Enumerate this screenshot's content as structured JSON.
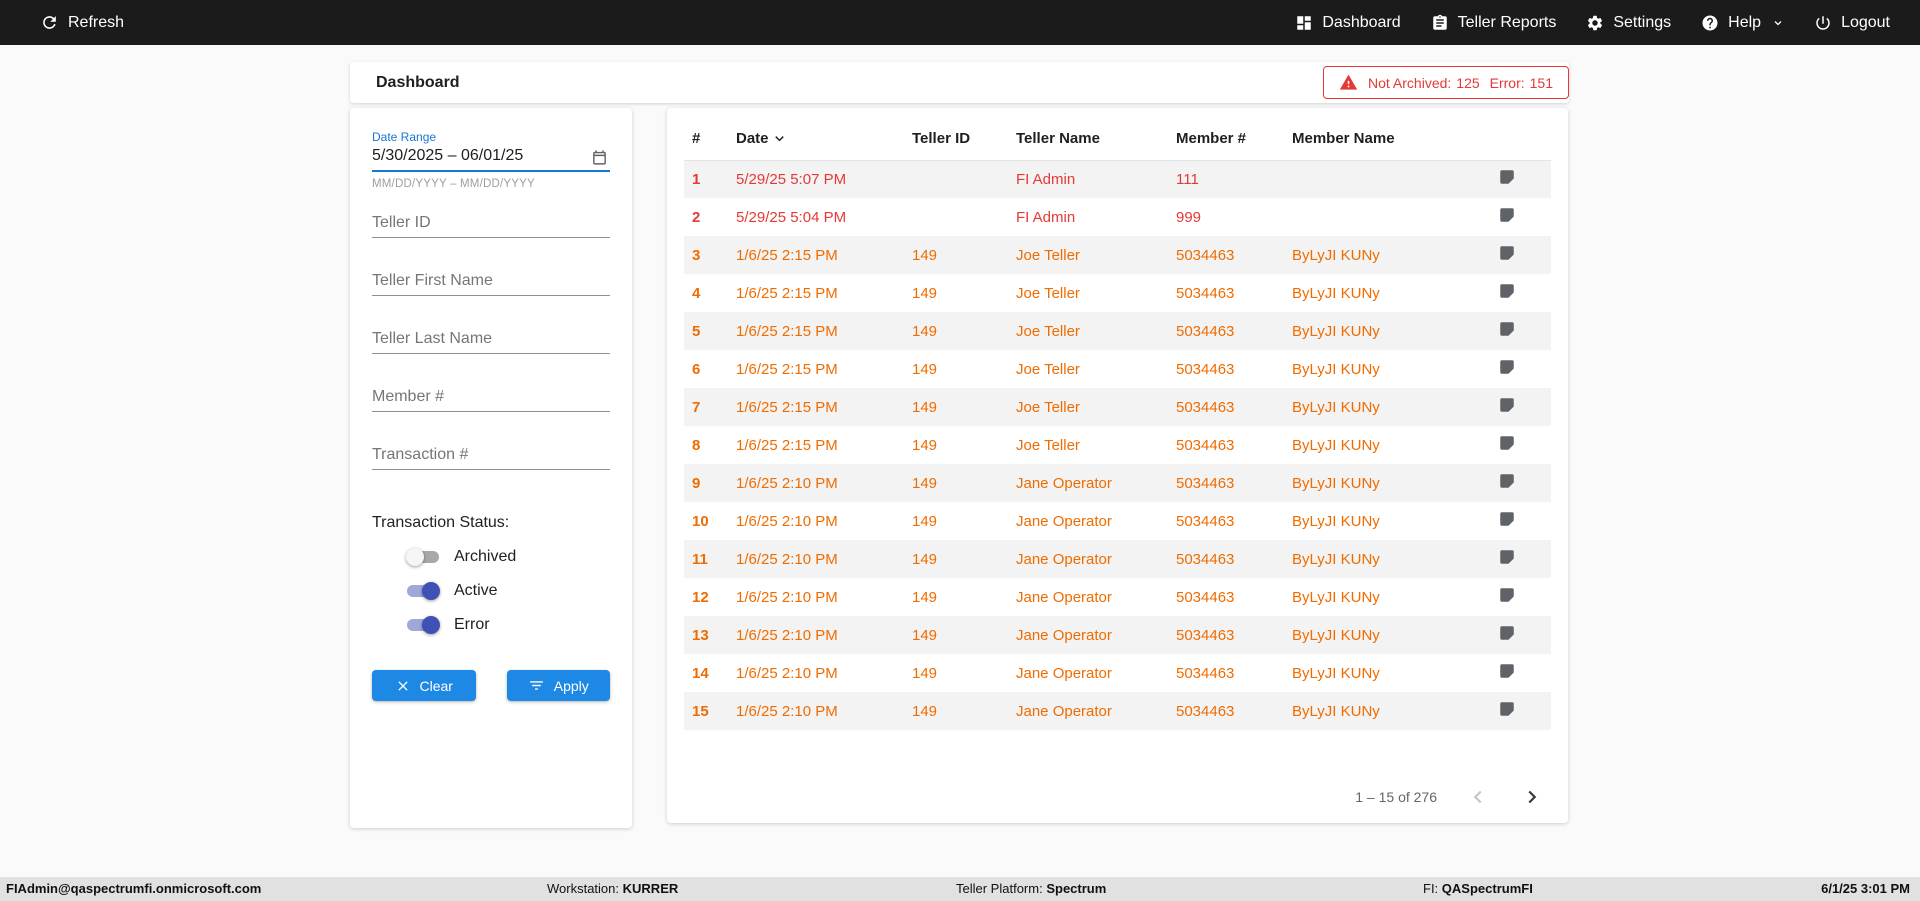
{
  "topbar": {
    "refresh_label": "Refresh",
    "nav": [
      {
        "label": "Dashboard"
      },
      {
        "label": "Teller Reports"
      },
      {
        "label": "Settings"
      },
      {
        "label": "Help"
      },
      {
        "label": "Logout"
      }
    ]
  },
  "page": {
    "title": "Dashboard"
  },
  "alert": {
    "not_archived_label": "Not Archived:",
    "not_archived_value": "125",
    "error_label": "Error:",
    "error_value": "151"
  },
  "filters": {
    "date_range": {
      "label": "Date Range",
      "value": "5/30/2025 – 06/01/25",
      "helper": "MM/DD/YYYY – MM/DD/YYYY"
    },
    "teller_id_placeholder": "Teller ID",
    "teller_first_name_placeholder": "Teller First Name",
    "teller_last_name_placeholder": "Teller Last Name",
    "member_num_placeholder": "Member #",
    "transaction_num_placeholder": "Transaction #",
    "status_label": "Transaction Status:",
    "toggles": [
      {
        "label": "Archived",
        "on": false
      },
      {
        "label": "Active",
        "on": true
      },
      {
        "label": "Error",
        "on": true
      }
    ],
    "clear_label": "Clear",
    "apply_label": "Apply"
  },
  "table": {
    "columns": [
      "#",
      "Date",
      "Teller ID",
      "Teller Name",
      "Member #",
      "Member Name"
    ],
    "sorted_column": "Date",
    "rows": [
      {
        "num": "1",
        "date": "5/29/25 5:07 PM",
        "teller_id": "",
        "teller_name": "FI Admin",
        "member_num": "111",
        "member_name": "",
        "color": "red"
      },
      {
        "num": "2",
        "date": "5/29/25 5:04 PM",
        "teller_id": "",
        "teller_name": "FI Admin",
        "member_num": "999",
        "member_name": "",
        "color": "red"
      },
      {
        "num": "3",
        "date": "1/6/25 2:15 PM",
        "teller_id": "149",
        "teller_name": "Joe Teller",
        "member_num": "5034463",
        "member_name": "ByLyJI KUNy",
        "color": "orange"
      },
      {
        "num": "4",
        "date": "1/6/25 2:15 PM",
        "teller_id": "149",
        "teller_name": "Joe Teller",
        "member_num": "5034463",
        "member_name": "ByLyJI KUNy",
        "color": "orange"
      },
      {
        "num": "5",
        "date": "1/6/25 2:15 PM",
        "teller_id": "149",
        "teller_name": "Joe Teller",
        "member_num": "5034463",
        "member_name": "ByLyJI KUNy",
        "color": "orange"
      },
      {
        "num": "6",
        "date": "1/6/25 2:15 PM",
        "teller_id": "149",
        "teller_name": "Joe Teller",
        "member_num": "5034463",
        "member_name": "ByLyJI KUNy",
        "color": "orange"
      },
      {
        "num": "7",
        "date": "1/6/25 2:15 PM",
        "teller_id": "149",
        "teller_name": "Joe Teller",
        "member_num": "5034463",
        "member_name": "ByLyJI KUNy",
        "color": "orange"
      },
      {
        "num": "8",
        "date": "1/6/25 2:15 PM",
        "teller_id": "149",
        "teller_name": "Joe Teller",
        "member_num": "5034463",
        "member_name": "ByLyJI KUNy",
        "color": "orange"
      },
      {
        "num": "9",
        "date": "1/6/25 2:10 PM",
        "teller_id": "149",
        "teller_name": "Jane Operator",
        "member_num": "5034463",
        "member_name": "ByLyJI KUNy",
        "color": "orange"
      },
      {
        "num": "10",
        "date": "1/6/25 2:10 PM",
        "teller_id": "149",
        "teller_name": "Jane Operator",
        "member_num": "5034463",
        "member_name": "ByLyJI KUNy",
        "color": "orange"
      },
      {
        "num": "11",
        "date": "1/6/25 2:10 PM",
        "teller_id": "149",
        "teller_name": "Jane Operator",
        "member_num": "5034463",
        "member_name": "ByLyJI KUNy",
        "color": "orange"
      },
      {
        "num": "12",
        "date": "1/6/25 2:10 PM",
        "teller_id": "149",
        "teller_name": "Jane Operator",
        "member_num": "5034463",
        "member_name": "ByLyJI KUNy",
        "color": "orange"
      },
      {
        "num": "13",
        "date": "1/6/25 2:10 PM",
        "teller_id": "149",
        "teller_name": "Jane Operator",
        "member_num": "5034463",
        "member_name": "ByLyJI KUNy",
        "color": "orange"
      },
      {
        "num": "14",
        "date": "1/6/25 2:10 PM",
        "teller_id": "149",
        "teller_name": "Jane Operator",
        "member_num": "5034463",
        "member_name": "ByLyJI KUNy",
        "color": "orange"
      },
      {
        "num": "15",
        "date": "1/6/25 2:10 PM",
        "teller_id": "149",
        "teller_name": "Jane Operator",
        "member_num": "5034463",
        "member_name": "ByLyJI KUNy",
        "color": "orange"
      }
    ],
    "pagination": {
      "range_label": "1 – 15 of 276"
    }
  },
  "footer": {
    "user": "FIAdmin@qaspectrumfi.onmicrosoft.com",
    "workstation_label": "Workstation:",
    "workstation_value": "KURRER",
    "platform_label": "Teller Platform:",
    "platform_value": "Spectrum",
    "fi_label": "FI:",
    "fi_value": "QASpectrumFI",
    "datetime": "6/1/25 3:01 PM"
  },
  "colors": {
    "accent_blue": "#1e88e5",
    "focus_blue": "#1976d2",
    "error_red": "#e53935",
    "warning_orange": "#ef6c00",
    "toggle_on": "#3f51b5"
  }
}
